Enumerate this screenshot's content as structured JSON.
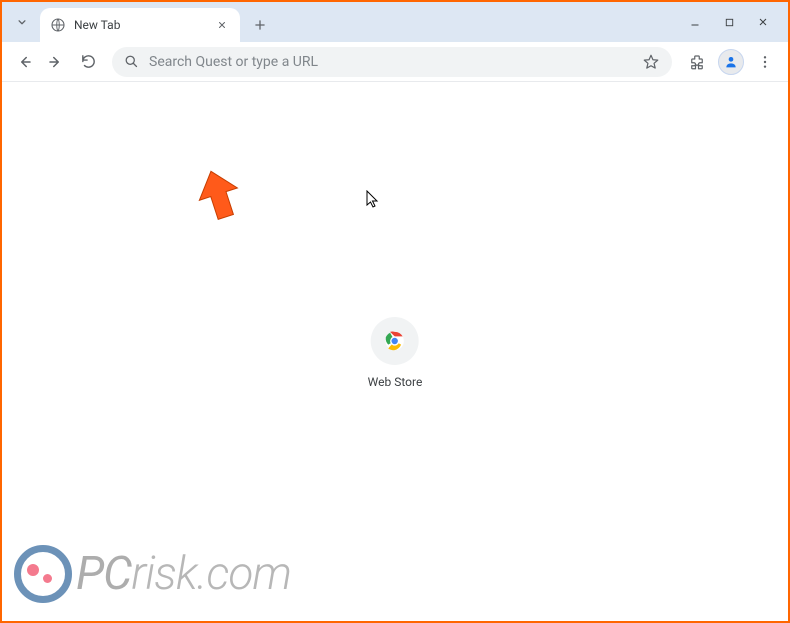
{
  "tab": {
    "title": "New Tab"
  },
  "omnibox": {
    "placeholder": "Search Quest or type a URL"
  },
  "shortcuts": [
    {
      "label": "Web Store"
    }
  ],
  "watermark": {
    "pc": "PC",
    "rest": "risk.com"
  }
}
